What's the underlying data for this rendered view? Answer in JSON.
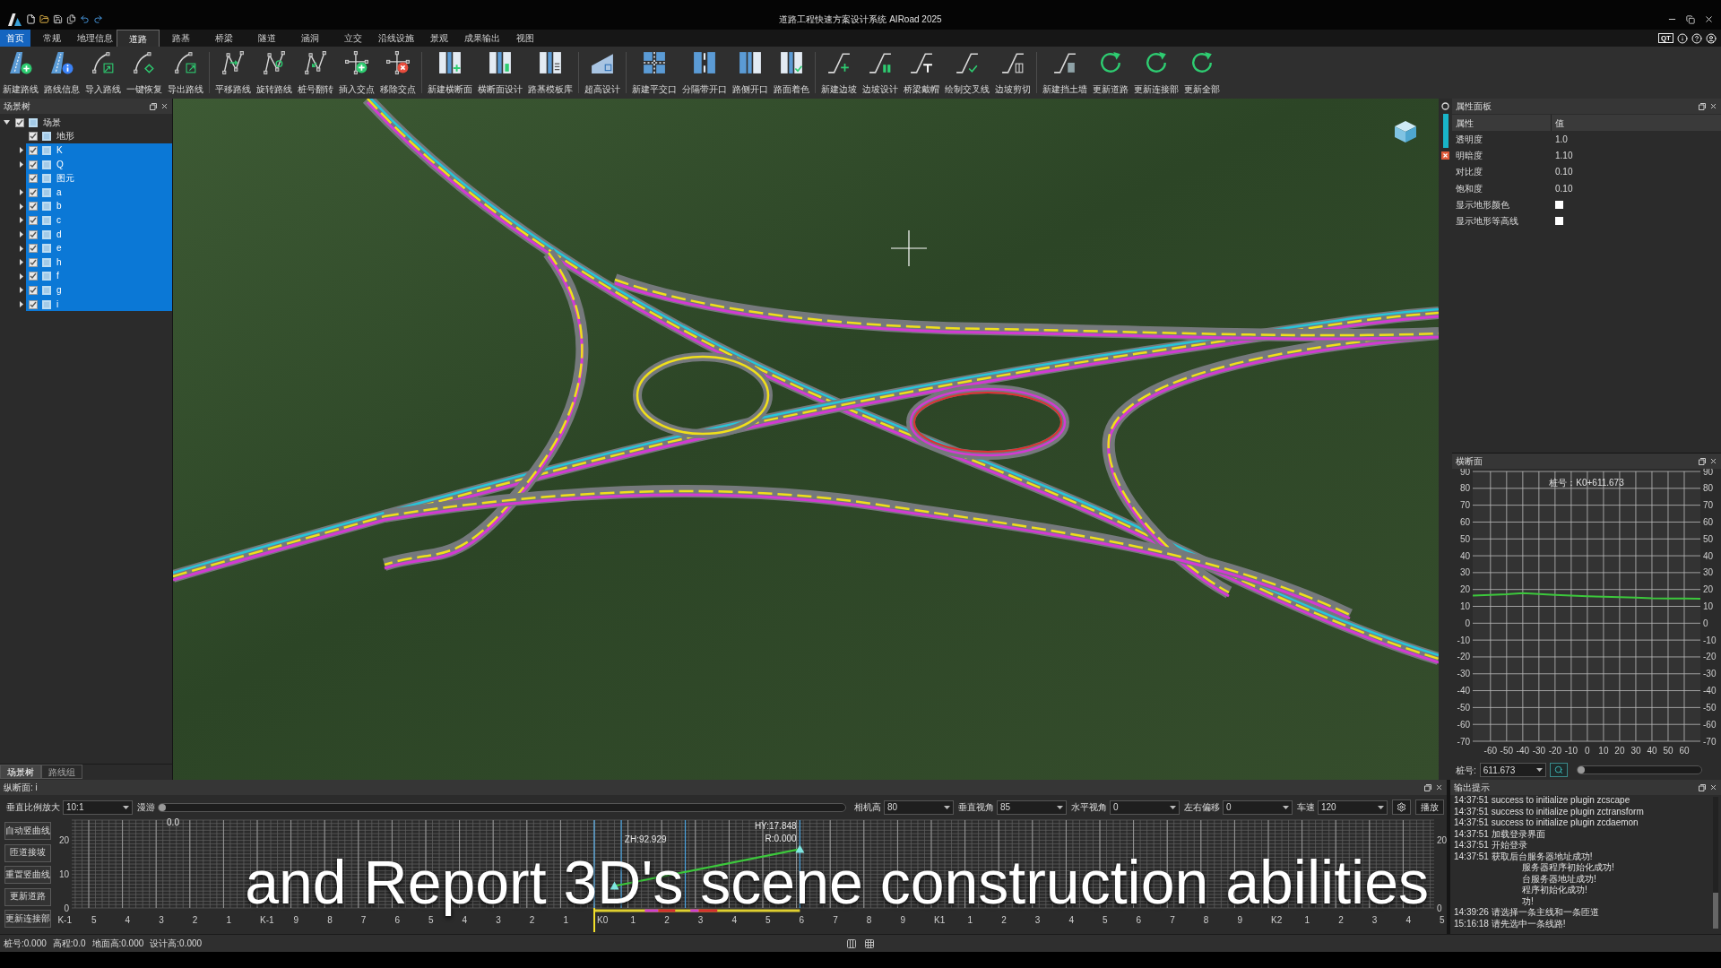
{
  "window": {
    "title": "道路工程快速方案设计系统 AIRoad 2025",
    "badge": "QT"
  },
  "menu_tabs": [
    {
      "label": "首页",
      "kind": "home",
      "selected": false
    },
    {
      "label": "常规",
      "kind": "tab",
      "selected": false
    },
    {
      "label": "地理信息",
      "kind": "tab",
      "selected": false
    },
    {
      "label": "道路",
      "kind": "tab",
      "selected": true
    },
    {
      "label": "路基",
      "kind": "tab",
      "selected": false
    },
    {
      "label": "桥梁",
      "kind": "tab",
      "selected": false
    },
    {
      "label": "隧道",
      "kind": "tab",
      "selected": false
    },
    {
      "label": "涵洞",
      "kind": "tab",
      "selected": false
    },
    {
      "label": "立交",
      "kind": "tab",
      "selected": false
    },
    {
      "label": "沿线设施",
      "kind": "tab",
      "selected": false
    },
    {
      "label": "景观",
      "kind": "tab",
      "selected": false
    },
    {
      "label": "成果输出",
      "kind": "tab",
      "selected": false
    },
    {
      "label": "视图",
      "kind": "tab",
      "selected": false
    }
  ],
  "ribbon_groups": [
    [
      "新建路线",
      "路线信息",
      "导入路线",
      "一键恢复",
      "导出路线"
    ],
    [
      "平移路线",
      "旋转路线",
      "桩号翻转",
      "插入交点",
      "移除交点"
    ],
    [
      "新建横断面",
      "横断面设计",
      "路基模板库"
    ],
    [
      "超高设计"
    ],
    [
      "新建平交口",
      "分隔带开口",
      "路侧开口",
      "路面着色"
    ],
    [
      "新建边坡",
      "边坡设计",
      "桥梁戴帽",
      "绘制交叉线",
      "边坡剪切"
    ],
    [
      "新建挡土墙",
      "更新道路",
      "更新连接部",
      "更新全部"
    ]
  ],
  "scene_tree": {
    "title": "场景树",
    "items": [
      {
        "label": "场景",
        "checked": true,
        "selected": false,
        "expanded": true,
        "children": [
          {
            "label": "地形",
            "checked": true,
            "selected": false
          },
          {
            "label": "K",
            "checked": true,
            "selected": true,
            "expanded": false
          },
          {
            "label": "Q",
            "checked": true,
            "selected": true,
            "expanded": false
          },
          {
            "label": "图元",
            "checked": true,
            "selected": true
          },
          {
            "label": "a",
            "checked": true,
            "selected": true,
            "expanded": false
          },
          {
            "label": "b",
            "checked": true,
            "selected": true,
            "expanded": false
          },
          {
            "label": "c",
            "checked": true,
            "selected": true,
            "expanded": false
          },
          {
            "label": "d",
            "checked": true,
            "selected": true,
            "expanded": false
          },
          {
            "label": "e",
            "checked": true,
            "selected": true,
            "expanded": false
          },
          {
            "label": "h",
            "checked": true,
            "selected": true,
            "expanded": false
          },
          {
            "label": "f",
            "checked": true,
            "selected": true,
            "expanded": false
          },
          {
            "label": "g",
            "checked": true,
            "selected": true,
            "expanded": false
          },
          {
            "label": "i",
            "checked": true,
            "selected": true,
            "expanded": false
          }
        ]
      }
    ]
  },
  "left_tabs": [
    {
      "label": "场景树",
      "selected": true
    },
    {
      "label": "路线组",
      "selected": false
    }
  ],
  "property_panel": {
    "title": "属性面板",
    "columns": [
      "属性",
      "值"
    ],
    "rows": [
      {
        "kind": "text",
        "name": "透明度",
        "value": "1.0"
      },
      {
        "kind": "text",
        "name": "明暗度",
        "value": "1.10"
      },
      {
        "kind": "text",
        "name": "对比度",
        "value": "0.10"
      },
      {
        "kind": "text",
        "name": "饱和度",
        "value": "0.10"
      },
      {
        "kind": "checkbox",
        "name": "显示地形颜色",
        "checked": false
      },
      {
        "kind": "checkbox",
        "name": "显示地形等高线",
        "checked": false
      }
    ]
  },
  "cross_section": {
    "title": "横断面",
    "left_axis_labels": [
      "90",
      "80",
      "70",
      "60",
      "50",
      "40",
      "30",
      "20",
      "10",
      "0",
      "-10",
      "-20",
      "-30",
      "-40",
      "-50",
      "-60",
      "-70"
    ],
    "chart_data": {
      "type": "line",
      "title": "桩号：K0+611.673",
      "x": [
        -71,
        -60,
        -50,
        -40,
        -30,
        -20,
        -10,
        0,
        10,
        20,
        30,
        40,
        50,
        60,
        70
      ],
      "series": [
        {
          "color": "#3cc83c",
          "values": [
            16.4,
            16.8,
            17.2,
            17.8,
            17.3,
            16.8,
            16.3,
            16.0,
            15.7,
            15.5,
            15.2,
            14.8,
            14.7,
            14.6,
            14.5
          ]
        }
      ],
      "xlim": [
        -71,
        70
      ],
      "ylim": [
        -70,
        90
      ],
      "xticks": [
        -60,
        -50,
        -40,
        -30,
        -20,
        -10,
        0,
        10,
        20,
        30,
        40,
        50,
        60
      ],
      "yticks": [
        -70,
        -60,
        -50,
        -40,
        -30,
        -20,
        -10,
        0,
        10,
        20,
        30,
        40,
        50,
        60,
        70,
        80,
        90
      ],
      "grid": true
    },
    "station_label": "桩号:",
    "station_value": "611.673",
    "slider": {
      "level": 0
    }
  },
  "profile": {
    "title": "纵断面: i",
    "toolbar": [
      {
        "kind": "select",
        "label": "垂直比例放大",
        "value": "10:1"
      },
      {
        "kind": "slider",
        "label": "漫游",
        "level": 0
      },
      {
        "kind": "select",
        "label": "相机高",
        "value": "80"
      },
      {
        "kind": "select",
        "label": "垂直视角",
        "value": "85"
      },
      {
        "kind": "select",
        "label": "水平视角",
        "value": "0"
      },
      {
        "kind": "select",
        "label": "左右偏移",
        "value": "0"
      },
      {
        "kind": "select",
        "label": "车速",
        "value": "120"
      },
      {
        "kind": "settings"
      },
      {
        "kind": "button",
        "label": "播放"
      }
    ],
    "side_buttons": [
      "自动竖曲线",
      "匝道接坡",
      "重置竖曲线",
      "更新道路",
      "更新连接部"
    ],
    "axis_x_labels": [
      "K-1",
      "5",
      "4",
      "3",
      "2",
      "1",
      "K-1",
      "9",
      "8",
      "7",
      "6",
      "5",
      "4",
      "3",
      "2",
      "1",
      "K0",
      "1",
      "2",
      "3",
      "4",
      "5",
      "6",
      "7",
      "8",
      "9",
      "K1",
      "1",
      "2",
      "3",
      "4",
      "5",
      "6",
      "7",
      "8",
      "9",
      "K2",
      "1",
      "2",
      "3",
      "4",
      "5"
    ],
    "axis_y_labels": [
      "20",
      "10",
      "0"
    ],
    "axis_y_right_labels": [
      "20",
      "0"
    ],
    "line_labels": [
      "0.0",
      "ZH:92.929",
      "HY:17.848",
      "R:0.000"
    ]
  },
  "output": {
    "title": "输出提示",
    "lines": [
      {
        "kind": "full",
        "text": "14:37:51 success to initialize plugin zcscape"
      },
      {
        "kind": "full",
        "text": "14:37:51 success to initialize plugin zctransform"
      },
      {
        "kind": "full",
        "text": "14:37:51 success to initialize plugin zcdaemon"
      },
      {
        "kind": "full",
        "text": "14:37:51 加载登录界面"
      },
      {
        "kind": "full",
        "text": "14:37:51 开始登录"
      },
      {
        "kind": "full",
        "text": "14:37:51 获取后台服务器地址成功!"
      },
      {
        "kind": "tail",
        "text": "服务器程序初始化成功!"
      },
      {
        "kind": "tail",
        "text": "台服务器地址成功!"
      },
      {
        "kind": "tail",
        "text": "程序初始化成功!"
      },
      {
        "kind": "tail",
        "text": "功!"
      },
      {
        "kind": "full",
        "text": "14:39:26 请选择一条主线和一条匝道"
      },
      {
        "kind": "full",
        "text": "15:16:18 请先选中一条线路!"
      }
    ]
  },
  "status_bar": [
    "桩号:0.000",
    "高程:0.0",
    "地面高:0.000",
    "设计高:0.000"
  ],
  "subtitle": "and Report 3D's scene construction abilities"
}
